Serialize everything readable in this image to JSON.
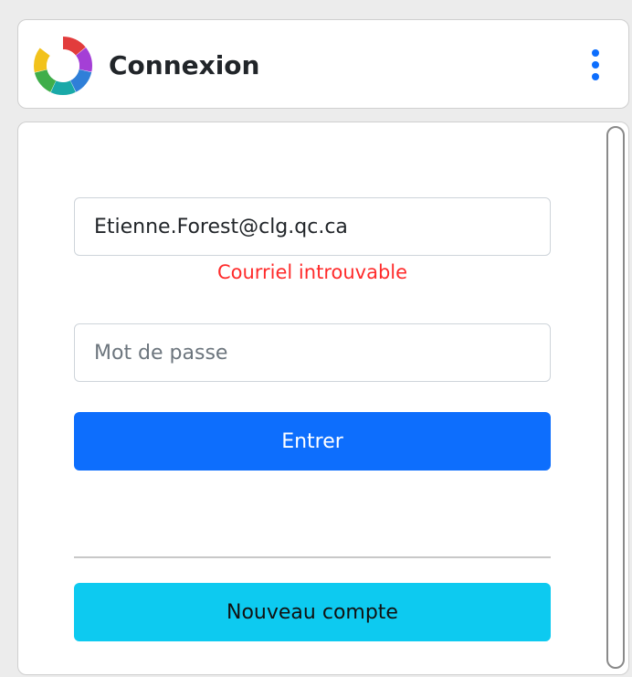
{
  "header": {
    "title": "Connexion",
    "logo_icon": "aperture-logo-icon",
    "menu_icon": "kebab-menu-icon"
  },
  "login_form": {
    "email_value": "Etienne.Forest@clg.qc.ca",
    "email_error": "Courriel introuvable",
    "password_placeholder": "Mot de passe",
    "submit_label": "Entrer",
    "new_account_label": "Nouveau compte"
  },
  "colors": {
    "primary": "#0d6efd",
    "info": "#0dcaf0",
    "error": "#ff2b2b"
  }
}
